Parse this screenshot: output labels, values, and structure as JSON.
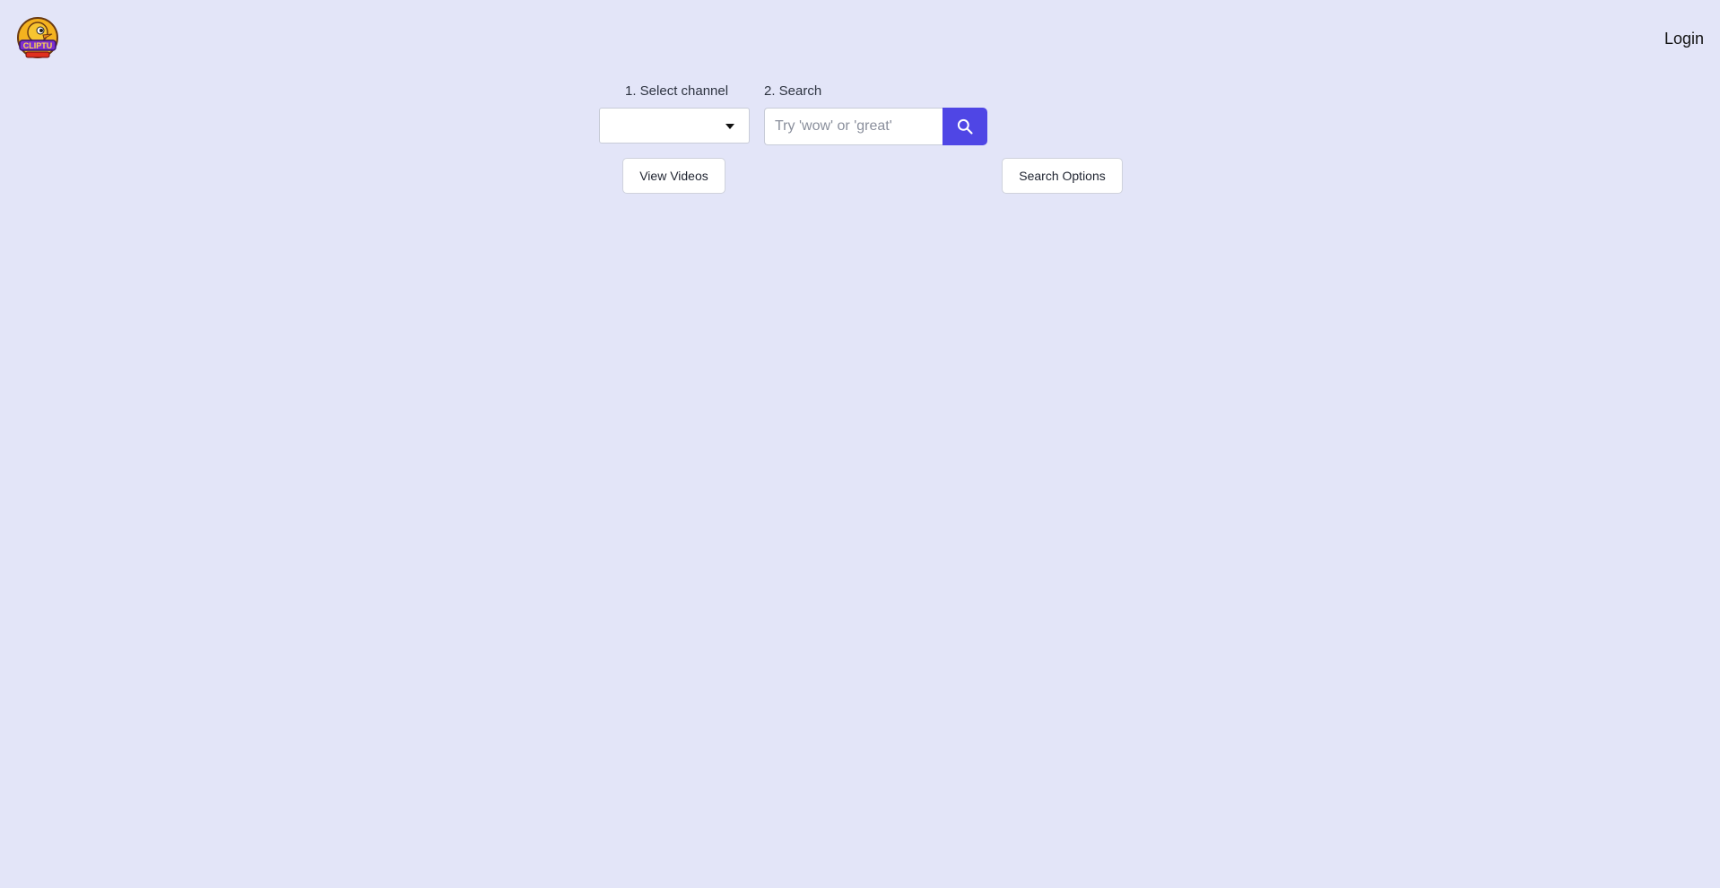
{
  "header": {
    "login_label": "Login"
  },
  "logo": {
    "text": "CLIPTU",
    "icon": "duck-logo-icon"
  },
  "controls": {
    "channel_label": "1. Select channel",
    "channel_selected": "",
    "search_label": "2. Search",
    "search_placeholder": "Try 'wow' or 'great'",
    "search_value": "",
    "search_icon": "search-icon",
    "view_videos_label": "View Videos",
    "search_options_label": "Search Options"
  },
  "colors": {
    "background": "#e3e5f8",
    "accent": "#4f46e5"
  }
}
